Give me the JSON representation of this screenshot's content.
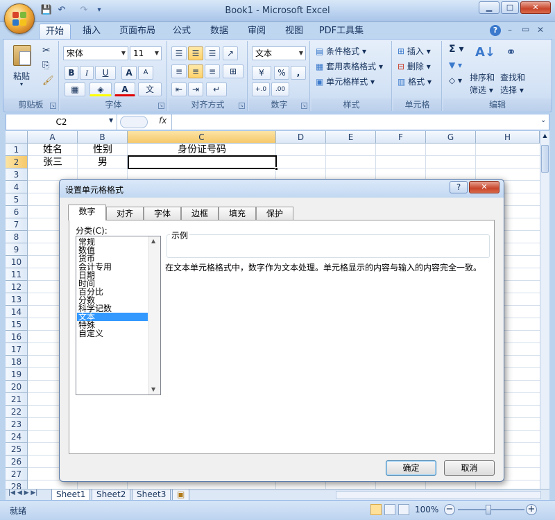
{
  "app": {
    "title": "Book1 - Microsoft Excel",
    "window_buttons": {
      "minimize": "▁",
      "maximize": "□",
      "close": "✕"
    },
    "mdi_buttons": {
      "help": "?",
      "minimize": "–",
      "restore": "▭",
      "close": "✕"
    }
  },
  "quick_access": {
    "save": "💾",
    "undo": "↶",
    "redo": "↷",
    "customize": "▾"
  },
  "ribbon_tabs": [
    "开始",
    "插入",
    "页面布局",
    "公式",
    "数据",
    "审阅",
    "视图",
    "PDF工具集"
  ],
  "ribbon": {
    "clipboard": {
      "label": "剪贴板",
      "paste": "粘贴"
    },
    "font": {
      "label": "字体",
      "name": "宋体",
      "size": "11",
      "bold": "B",
      "italic": "I",
      "underline": "U",
      "grow": "A",
      "shrink": "A",
      "wen": "文"
    },
    "alignment": {
      "label": "对齐方式"
    },
    "number": {
      "label": "数字",
      "format": "文本",
      "percent": "%",
      "comma": ","
    },
    "styles": {
      "label": "样式",
      "conditional": "条件格式",
      "table": "套用表格格式",
      "cell": "单元格样式"
    },
    "cells": {
      "label": "单元格",
      "insert": "插入",
      "delete": "删除",
      "format": "格式"
    },
    "editing": {
      "label": "编辑",
      "sum": "Σ",
      "sort": "排序和",
      "sort2": "筛选",
      "find": "查找和",
      "find2": "选择"
    }
  },
  "formula_bar": {
    "name_box": "C2",
    "fx": "fx"
  },
  "grid": {
    "columns": [
      "A",
      "B",
      "C",
      "D",
      "E",
      "F",
      "G",
      "H"
    ],
    "rows": [
      "1",
      "2",
      "3",
      "4",
      "5",
      "6",
      "7",
      "8",
      "9",
      "10",
      "11",
      "12",
      "13",
      "14",
      "15",
      "16",
      "17",
      "18",
      "19",
      "20",
      "21",
      "22",
      "23",
      "24",
      "25",
      "26",
      "27",
      "28"
    ],
    "cells": {
      "A1": "姓名",
      "B1": "性别",
      "C1": "身份证号码",
      "A2": "张三",
      "B2": "男"
    }
  },
  "sheets": [
    "Sheet1",
    "Sheet2",
    "Sheet3"
  ],
  "status": {
    "ready": "就绪",
    "zoom": "100%",
    "minus": "−",
    "plus": "+"
  },
  "dialog": {
    "title": "设置单元格格式",
    "help": "?",
    "close": "✕",
    "tabs": [
      "数字",
      "对齐",
      "字体",
      "边框",
      "填充",
      "保护"
    ],
    "category_label": "分类(C):",
    "categories": [
      "常规",
      "数值",
      "货币",
      "会计专用",
      "日期",
      "时间",
      "百分比",
      "分数",
      "科学记数",
      "文本",
      "特殊",
      "自定义"
    ],
    "selected_category": "文本",
    "sample_label": "示例",
    "description": "在文本单元格格式中，数字作为文本处理。单元格显示的内容与输入的内容完全一致。",
    "ok": "确定",
    "cancel": "取消"
  }
}
